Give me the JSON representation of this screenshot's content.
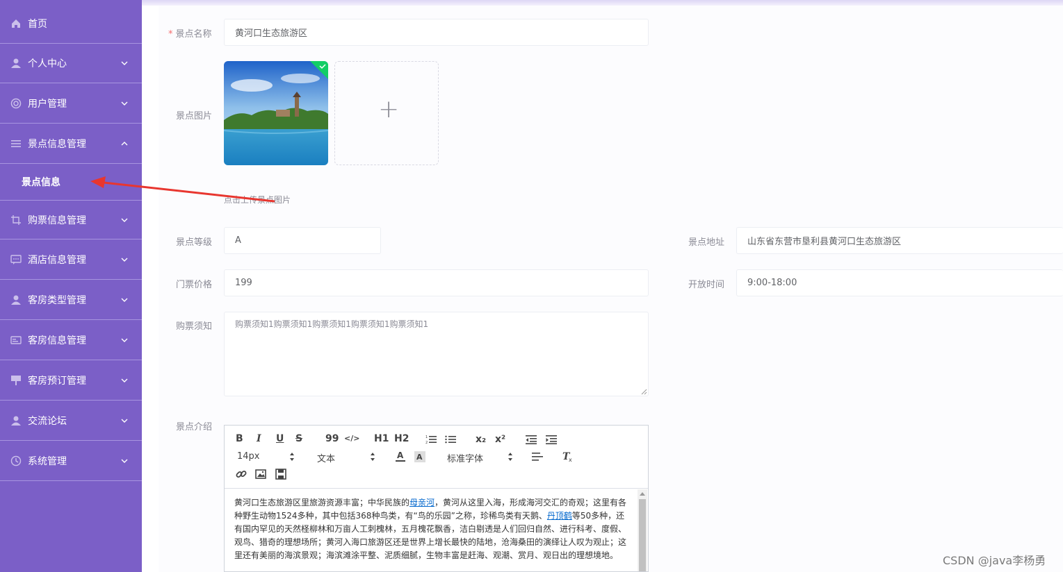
{
  "sidebar": {
    "items": [
      {
        "label": "首页",
        "icon": "home-icon"
      },
      {
        "label": "个人中心",
        "icon": "user-icon"
      },
      {
        "label": "用户管理",
        "icon": "users-icon"
      },
      {
        "label": "景点信息管理",
        "icon": "list-icon",
        "expanded": true
      },
      {
        "label": "购票信息管理",
        "icon": "crop-icon"
      },
      {
        "label": "酒店信息管理",
        "icon": "chat-icon"
      },
      {
        "label": "客房类型管理",
        "icon": "user-icon"
      },
      {
        "label": "客房信息管理",
        "icon": "card-icon"
      },
      {
        "label": "客房预订管理",
        "icon": "sign-icon"
      },
      {
        "label": "交流论坛",
        "icon": "user-icon"
      },
      {
        "label": "系统管理",
        "icon": "clock-icon"
      }
    ],
    "sub_items": [
      {
        "label": "景点信息"
      }
    ]
  },
  "form": {
    "name": {
      "label": "景点名称",
      "value": "黄河口生态旅游区",
      "required_mark": "*"
    },
    "image": {
      "label": "景点图片",
      "hint": "点击上传景点图片",
      "add_symbol": "+"
    },
    "level": {
      "label": "景点等级",
      "value": "A"
    },
    "address": {
      "label": "景点地址",
      "value": "山东省东营市垦利县黄河口生态旅游区"
    },
    "price": {
      "label": "门票价格",
      "value": "199"
    },
    "open_time": {
      "label": "开放时间",
      "value": "9:00-18:00"
    },
    "notice": {
      "label": "购票须知",
      "value": "购票须知1购票须知1购票须知1购票须知1购票须知1"
    },
    "intro": {
      "label": "景点介绍",
      "toolbar": {
        "row1": [
          "B",
          "I",
          "U",
          "S",
          "99",
          "</>",
          "H1",
          "H2",
          "ol",
          "ul",
          "x₂",
          "x²",
          "outdent",
          "indent"
        ],
        "font_size": "14px",
        "text_type": "文本",
        "font_family": "标准字体"
      },
      "content": {
        "seg1": "黄河口生态旅游区里旅游资源丰富；中华民族的",
        "link1": "母亲河",
        "seg2": "，黄河从这里入海，形成海河交汇的奇观；这里有各种野生动物1524多种，其中包括368种鸟类，有“鸟的乐园”之称，珍稀鸟类有天鹅、",
        "link2": "丹顶鹤",
        "seg3": "等50多种，还有国内罕见的天然柽柳林和万亩人工刺槐林，五月槐花飘香，洁白剔透是人们回归自然、进行科考、度假、观鸟、猎奇的理想场所；黄河入海口旅游区还是世界上增长最快的陆地，沧海桑田的演绎让人叹为观止；这里还有美丽的海滨景观；海滨滩涂平整、泥质细腻，生物丰富是赶海、观潮、赏月、观日出的理想境地。"
      }
    }
  },
  "watermark": "CSDN @java李杨勇",
  "colors": {
    "sidebar": "#7b5fc7",
    "arrow": "#e8362f",
    "link": "#0066cc"
  }
}
